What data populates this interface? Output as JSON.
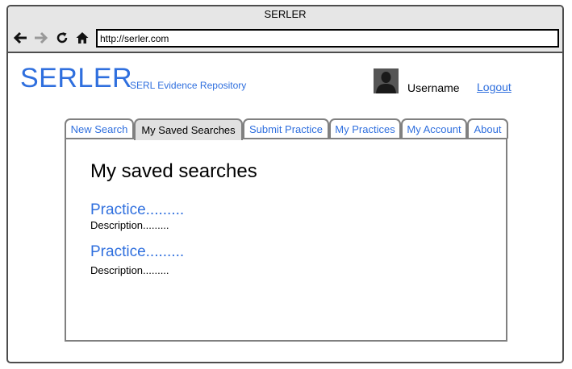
{
  "window": {
    "title": "SERLER"
  },
  "navigation": {
    "back_icon": "arrow-left-icon",
    "forward_icon": "arrow-right-icon",
    "reload_icon": "reload-icon",
    "home_icon": "home-icon"
  },
  "address_bar": {
    "url": "http://serler.com"
  },
  "header": {
    "brand": "SERLER",
    "subtitle": "SERL Evidence Repository",
    "username": "Username",
    "logout": "Logout"
  },
  "tabs": [
    {
      "label": "New Search",
      "active": false
    },
    {
      "label": "My Saved Searches",
      "active": true
    },
    {
      "label": "Submit Practice",
      "active": false
    },
    {
      "label": "My Practices",
      "active": false
    },
    {
      "label": "My Account",
      "active": false
    },
    {
      "label": "About",
      "active": false
    }
  ],
  "content": {
    "title": "My saved searches",
    "results": [
      {
        "title": "Practice.........",
        "description": "Description........."
      },
      {
        "title": "Practice.........",
        "description": "Description........."
      }
    ]
  },
  "colors": {
    "accent": "#2f6fde",
    "chrome": "#e6e6e6",
    "border": "#4d4d4d",
    "active_tab": "#e0e0e0"
  }
}
